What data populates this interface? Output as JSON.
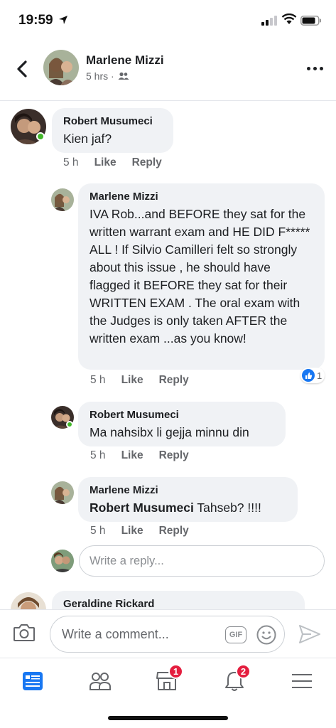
{
  "status_bar": {
    "time": "19:59"
  },
  "header": {
    "name": "Marlene Mizzi",
    "meta": "5 hrs ·"
  },
  "comments": [
    {
      "name": "Robert Musumeci",
      "text": "Kien jaf?",
      "time": "5 h",
      "like": "Like",
      "reply": "Reply"
    },
    {
      "name": "Marlene Mizzi",
      "text": "IVA Rob...and BEFORE they sat for the written warrant exam and HE DID F***** ALL !  If Silvio Camilleri felt so strongly about this issue , he should have flagged it BEFORE they sat for their WRITTEN EXAM . The oral exam with the Judges is only taken AFTER the written exam ...as you know!",
      "time": "5 h",
      "like": "Like",
      "reply": "Reply",
      "reaction_count": "1"
    },
    {
      "name": "Robert Musumeci",
      "text": "Ma nahsibx li gejja minnu din",
      "time": "5 h",
      "like": "Like",
      "reply": "Reply"
    },
    {
      "name": "Marlene Mizzi",
      "mention": "Robert Musumeci",
      "text": " Tahseb? !!!!",
      "time": "5 h",
      "like": "Like",
      "reply": "Reply"
    },
    {
      "name": "Geraldine Rickard"
    }
  ],
  "reply_input": {
    "placeholder": "Write a reply..."
  },
  "composer": {
    "placeholder": "Write a comment...",
    "gif_label": "GIF"
  },
  "tabbar": {
    "marketplace_badge": "1",
    "notifications_badge": "2"
  },
  "colors": {
    "accent": "#1877f2",
    "bubble": "#f0f2f5",
    "badge": "#e41e3f",
    "online": "#42b72a"
  }
}
